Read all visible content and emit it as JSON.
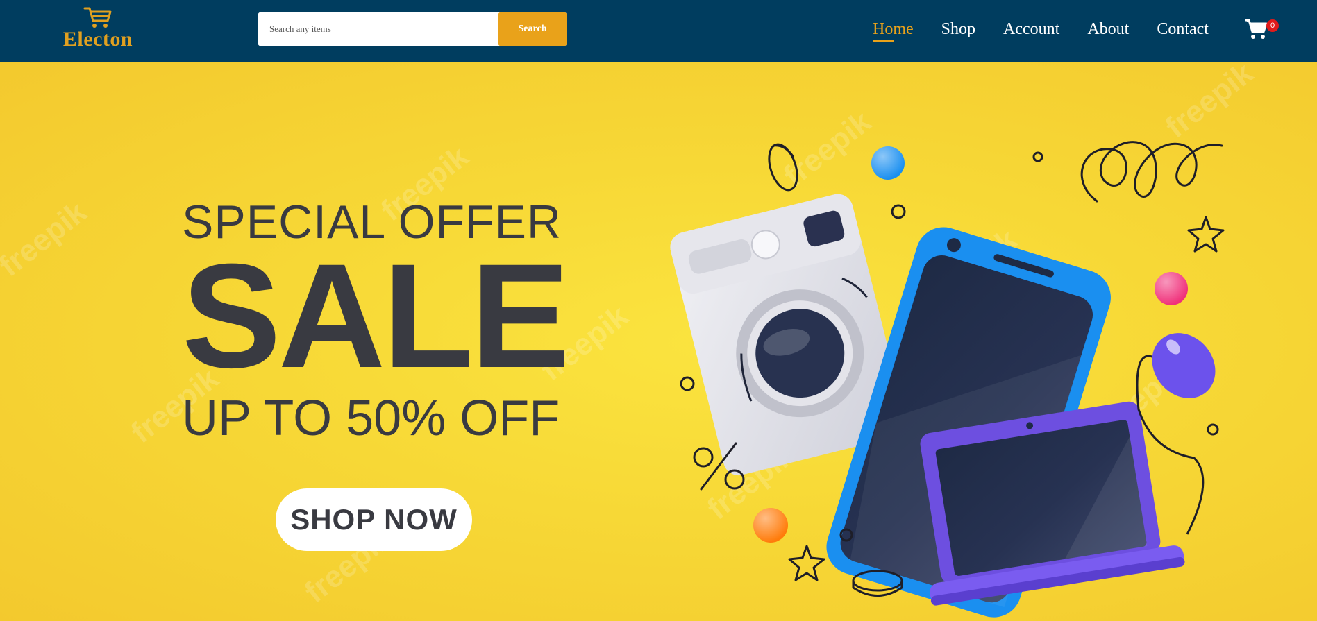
{
  "brand": {
    "name": "Electon",
    "logo_icon": "shopping-cart-icon",
    "color": "#e0a020"
  },
  "search": {
    "placeholder": "Search any items",
    "value": "",
    "button_label": "Search"
  },
  "nav": {
    "items": [
      {
        "label": "Home",
        "active": true
      },
      {
        "label": "Shop",
        "active": false
      },
      {
        "label": "Account",
        "active": false
      },
      {
        "label": "About",
        "active": false
      },
      {
        "label": "Contact",
        "active": false
      }
    ]
  },
  "cart": {
    "icon": "shopping-cart-icon",
    "count": "0"
  },
  "hero": {
    "line1": "SPECIAL OFFER",
    "line2": "SALE",
    "line3": "UP TO 50% OFF",
    "cta": "SHOP NOW",
    "percent_symbol": "%",
    "watermark": "freepik"
  },
  "colors": {
    "navbar": "#003d5f",
    "accent": "#e9a21a",
    "hero_bg": "#f6d535",
    "hero_text": "#393a41",
    "badge": "#e01b1b"
  }
}
